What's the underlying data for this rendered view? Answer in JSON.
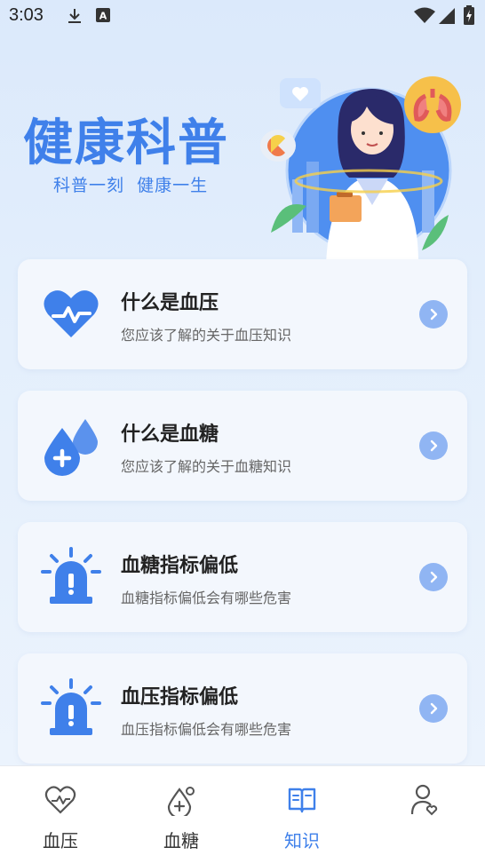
{
  "status_bar": {
    "time": "3:03",
    "icons": [
      "download-icon",
      "a-badge-icon",
      "wifi-icon",
      "signal-icon",
      "battery-icon"
    ]
  },
  "hero": {
    "title": "健康科普",
    "subtitle": "科普一刻  健康一生"
  },
  "cards": [
    {
      "title": "什么是血压",
      "desc": "您应该了解的关于血压知识",
      "icon": "heart-pulse-icon"
    },
    {
      "title": "什么是血糖",
      "desc": "您应该了解的关于血糖知识",
      "icon": "blood-drop-icon"
    },
    {
      "title": "血糖指标偏低",
      "desc": "血糖指标偏低会有哪些危害",
      "icon": "alarm-icon"
    },
    {
      "title": "血压指标偏低",
      "desc": "血压指标偏低会有哪些危害",
      "icon": "alarm-icon"
    }
  ],
  "tabs": [
    {
      "label": "血压",
      "icon": "heart-pulse-outline-icon",
      "active": false
    },
    {
      "label": "血糖",
      "icon": "drop-outline-icon",
      "active": false
    },
    {
      "label": "知识",
      "icon": "book-icon",
      "active": true
    },
    {
      "label": "",
      "icon": "profile-icon",
      "active": false
    }
  ],
  "colors": {
    "accent": "#3f80ea",
    "arrow_bg": "#90b5f3",
    "card_bg": "#f3f7fd"
  }
}
